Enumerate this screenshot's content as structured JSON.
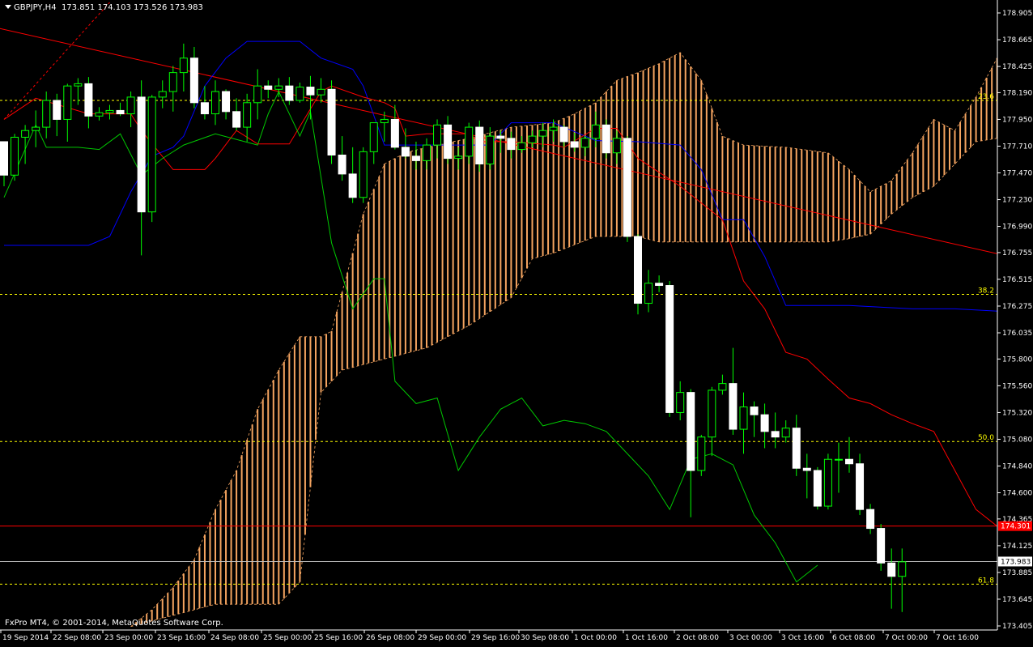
{
  "window": {
    "symbol_label": "GBPJPY,H4",
    "ohlc_label": "173.851 174.103 173.526 173.983",
    "copyright": "FxPro MT4, © 2001-2014, MetaQuotes Software Corp."
  },
  "colors": {
    "background": "#000000",
    "axis": "#ffffff",
    "bull_candle": "#000000",
    "bear_candle": "#ffffff",
    "wick": "#00ff00",
    "tenkan": "#ff0000",
    "kijun": "#0000ff",
    "chikou": "#00c800",
    "cloud_bull": "#f4a460",
    "cloud_bear": "#d8bfd8",
    "fib": "#ffff00",
    "trendline": "#ff0000",
    "hline": "#ff0000",
    "bid_line": "#c0c0c0"
  },
  "chart_data": {
    "type": "candlestick",
    "symbol": "GBPJPY",
    "timeframe": "H4",
    "ylim": [
      173.405,
      178.905
    ],
    "y_ticks": [
      "178.905",
      "178.665",
      "178.425",
      "178.190",
      "177.950",
      "177.710",
      "177.470",
      "177.230",
      "176.990",
      "176.755",
      "176.515",
      "176.275",
      "176.035",
      "175.800",
      "175.560",
      "175.320",
      "175.080",
      "174.840",
      "174.600",
      "174.365",
      "174.125",
      "173.885",
      "173.645",
      "173.405"
    ],
    "x_labels": [
      "19 Sep 2014",
      "22 Sep 08:00",
      "23 Sep 00:00",
      "23 Sep 16:00",
      "24 Sep 08:00",
      "25 Sep 00:00",
      "25 Sep 16:00",
      "26 Sep 08:00",
      "29 Sep 00:00",
      "29 Sep 16:00",
      "30 Sep 08:00",
      "1 Oct 00:00",
      "1 Oct 16:00",
      "2 Oct 08:00",
      "3 Oct 00:00",
      "3 Oct 16:00",
      "6 Oct 08:00",
      "7 Oct 00:00",
      "7 Oct 16:00"
    ],
    "candles": [
      [
        177.75,
        177.75,
        177.35,
        177.45
      ],
      [
        177.45,
        177.82,
        177.4,
        177.79
      ],
      [
        177.79,
        177.9,
        177.55,
        177.85
      ],
      [
        177.85,
        178.03,
        177.7,
        177.88
      ],
      [
        177.88,
        178.2,
        177.78,
        178.12
      ],
      [
        178.12,
        178.18,
        177.8,
        177.95
      ],
      [
        177.95,
        178.27,
        177.75,
        178.25
      ],
      [
        178.25,
        178.32,
        178.08,
        178.27
      ],
      [
        178.27,
        178.33,
        177.87,
        177.98
      ],
      [
        177.98,
        178.06,
        177.94,
        178.01
      ],
      [
        178.01,
        178.08,
        177.95,
        178.03
      ],
      [
        178.03,
        178.1,
        177.98,
        178.0
      ],
      [
        178.0,
        178.2,
        177.88,
        178.15
      ],
      [
        178.15,
        178.3,
        176.73,
        177.12
      ],
      [
        177.12,
        178.17,
        177.03,
        178.15
      ],
      [
        178.15,
        178.3,
        178.05,
        178.2
      ],
      [
        178.2,
        178.43,
        178.02,
        178.37
      ],
      [
        178.37,
        178.63,
        178.2,
        178.5
      ],
      [
        178.5,
        178.6,
        178.05,
        178.1
      ],
      [
        178.1,
        178.25,
        177.95,
        178.0
      ],
      [
        178.0,
        178.3,
        177.9,
        178.2
      ],
      [
        178.2,
        178.22,
        177.95,
        178.02
      ],
      [
        178.02,
        178.14,
        177.85,
        177.88
      ],
      [
        177.88,
        178.18,
        177.75,
        178.1
      ],
      [
        178.1,
        178.4,
        177.95,
        178.25
      ],
      [
        178.25,
        178.3,
        178.14,
        178.22
      ],
      [
        178.22,
        178.32,
        178.15,
        178.25
      ],
      [
        178.25,
        178.33,
        178.08,
        178.12
      ],
      [
        178.12,
        178.28,
        178.1,
        178.24
      ],
      [
        178.24,
        178.34,
        177.95,
        178.17
      ],
      [
        178.17,
        178.32,
        178.1,
        178.22
      ],
      [
        178.22,
        178.3,
        177.55,
        177.63
      ],
      [
        177.63,
        177.8,
        177.4,
        177.46
      ],
      [
        177.46,
        177.7,
        177.2,
        177.25
      ],
      [
        177.25,
        177.7,
        177.2,
        177.66
      ],
      [
        177.66,
        177.9,
        177.55,
        177.92
      ],
      [
        177.92,
        178.02,
        177.75,
        177.95
      ],
      [
        177.95,
        178.08,
        177.68,
        177.7
      ],
      [
        177.7,
        177.87,
        177.6,
        177.62
      ],
      [
        177.62,
        177.75,
        177.5,
        177.58
      ],
      [
        177.58,
        177.78,
        177.5,
        177.72
      ],
      [
        177.72,
        177.95,
        177.6,
        177.9
      ],
      [
        177.9,
        177.98,
        177.55,
        177.6
      ],
      [
        177.6,
        177.7,
        177.5,
        177.62
      ],
      [
        177.62,
        177.92,
        177.55,
        177.88
      ],
      [
        177.88,
        177.94,
        177.48,
        177.55
      ],
      [
        177.55,
        177.88,
        177.5,
        177.8
      ],
      [
        177.8,
        177.85,
        177.65,
        177.78
      ],
      [
        177.78,
        177.84,
        177.6,
        177.68
      ],
      [
        177.68,
        177.8,
        177.65,
        177.74
      ],
      [
        177.74,
        177.85,
        177.7,
        177.8
      ],
      [
        177.8,
        177.92,
        177.7,
        177.85
      ],
      [
        177.85,
        177.95,
        177.75,
        177.88
      ],
      [
        177.88,
        177.9,
        177.7,
        177.75
      ],
      [
        177.75,
        177.83,
        177.66,
        177.7
      ],
      [
        177.7,
        177.8,
        177.62,
        177.78
      ],
      [
        177.78,
        178.02,
        177.7,
        177.9
      ],
      [
        177.9,
        177.95,
        177.6,
        177.65
      ],
      [
        177.65,
        177.85,
        177.55,
        177.78
      ],
      [
        177.78,
        177.8,
        176.85,
        176.9
      ],
      [
        176.9,
        176.92,
        176.2,
        176.3
      ],
      [
        176.3,
        176.6,
        176.22,
        176.48
      ],
      [
        176.48,
        176.55,
        176.4,
        176.46
      ],
      [
        176.46,
        176.5,
        175.28,
        175.32
      ],
      [
        175.32,
        175.6,
        175.25,
        175.5
      ],
      [
        175.5,
        175.53,
        174.38,
        174.8
      ],
      [
        174.8,
        175.12,
        174.75,
        175.1
      ],
      [
        175.1,
        175.55,
        174.93,
        175.52
      ],
      [
        175.52,
        175.66,
        175.48,
        175.58
      ],
      [
        175.58,
        175.9,
        175.12,
        175.17
      ],
      [
        175.17,
        175.5,
        174.95,
        175.37
      ],
      [
        175.37,
        175.42,
        175.1,
        175.3
      ],
      [
        175.3,
        175.4,
        175.0,
        175.15
      ],
      [
        175.15,
        175.32,
        175.0,
        175.1
      ],
      [
        175.1,
        175.25,
        175.05,
        175.18
      ],
      [
        175.18,
        175.3,
        174.75,
        174.82
      ],
      [
        174.82,
        174.95,
        174.55,
        174.8
      ],
      [
        174.8,
        174.83,
        174.45,
        174.48
      ],
      [
        174.48,
        174.95,
        174.45,
        174.9
      ],
      [
        174.9,
        175.05,
        174.6,
        174.9
      ],
      [
        174.9,
        175.1,
        174.78,
        174.86
      ],
      [
        174.86,
        174.95,
        174.4,
        174.45
      ],
      [
        174.45,
        174.5,
        174.23,
        174.28
      ],
      [
        174.28,
        174.32,
        173.9,
        173.97
      ],
      [
        173.97,
        174.1,
        173.56,
        173.85
      ],
      [
        173.85,
        174.1,
        173.53,
        173.98
      ]
    ],
    "tenkan": [
      [
        0,
        177.95
      ],
      [
        3,
        178.14
      ],
      [
        8,
        178.0
      ],
      [
        12,
        178.0
      ],
      [
        13,
        177.85
      ],
      [
        16,
        177.5
      ],
      [
        19,
        177.5
      ],
      [
        20,
        177.6
      ],
      [
        22,
        177.85
      ],
      [
        24,
        177.73
      ],
      [
        26,
        177.73
      ],
      [
        27,
        177.73
      ],
      [
        30,
        178.2
      ],
      [
        31,
        178.25
      ],
      [
        34,
        178.15
      ],
      [
        36,
        178.1
      ],
      [
        37,
        178.05
      ],
      [
        38,
        177.8
      ],
      [
        40,
        177.82
      ],
      [
        44,
        177.82
      ],
      [
        45,
        177.75
      ],
      [
        48,
        177.75
      ],
      [
        52,
        177.72
      ],
      [
        53,
        177.7
      ],
      [
        56,
        177.87
      ],
      [
        58,
        177.87
      ],
      [
        60,
        177.6
      ],
      [
        64,
        177.35
      ],
      [
        68,
        177.05
      ],
      [
        70,
        176.5
      ],
      [
        72,
        176.25
      ],
      [
        74,
        175.86
      ],
      [
        76,
        175.8
      ],
      [
        78,
        175.62
      ],
      [
        80,
        175.45
      ],
      [
        82,
        175.4
      ],
      [
        84,
        175.3
      ],
      [
        86,
        175.22
      ],
      [
        88,
        175.15
      ],
      [
        90,
        174.8
      ],
      [
        92,
        174.45
      ],
      [
        94,
        174.3
      ],
      [
        96,
        174.2
      ],
      [
        98,
        174.15
      ],
      [
        100,
        174.1
      ]
    ],
    "kijun": [
      [
        0,
        176.82
      ],
      [
        8,
        176.82
      ],
      [
        10,
        176.9
      ],
      [
        12,
        177.3
      ],
      [
        14,
        177.62
      ],
      [
        16,
        177.7
      ],
      [
        17,
        177.8
      ],
      [
        19,
        178.25
      ],
      [
        21,
        178.5
      ],
      [
        23,
        178.65
      ],
      [
        28,
        178.65
      ],
      [
        30,
        178.5
      ],
      [
        33,
        178.4
      ],
      [
        34,
        178.25
      ],
      [
        36,
        177.72
      ],
      [
        40,
        177.72
      ],
      [
        44,
        177.72
      ],
      [
        46,
        177.72
      ],
      [
        48,
        177.92
      ],
      [
        52,
        177.92
      ],
      [
        56,
        177.76
      ],
      [
        60,
        177.75
      ],
      [
        64,
        177.72
      ],
      [
        66,
        177.5
      ],
      [
        68,
        177.05
      ],
      [
        70,
        177.05
      ],
      [
        72,
        176.72
      ],
      [
        74,
        176.28
      ],
      [
        78,
        176.28
      ],
      [
        80,
        176.28
      ],
      [
        86,
        176.25
      ],
      [
        90,
        176.25
      ],
      [
        96,
        176.22
      ],
      [
        98,
        175.95
      ],
      [
        100,
        175.3
      ]
    ],
    "senkou_a": [
      [
        12,
        173.4
      ],
      [
        14,
        173.55
      ],
      [
        16,
        173.75
      ],
      [
        18,
        174.0
      ],
      [
        20,
        174.45
      ],
      [
        22,
        174.8
      ],
      [
        24,
        175.35
      ],
      [
        26,
        175.7
      ],
      [
        28,
        176.0
      ],
      [
        30,
        176.0
      ],
      [
        31,
        176.05
      ],
      [
        32,
        176.4
      ],
      [
        34,
        177.1
      ],
      [
        36,
        177.55
      ],
      [
        38,
        177.65
      ],
      [
        40,
        177.7
      ],
      [
        44,
        177.78
      ],
      [
        48,
        177.88
      ],
      [
        52,
        177.92
      ],
      [
        54,
        178.0
      ],
      [
        56,
        178.1
      ],
      [
        58,
        178.3
      ],
      [
        60,
        178.37
      ],
      [
        62,
        178.45
      ],
      [
        64,
        178.55
      ],
      [
        66,
        178.3
      ],
      [
        68,
        177.8
      ],
      [
        70,
        177.72
      ],
      [
        74,
        177.7
      ],
      [
        78,
        177.65
      ],
      [
        80,
        177.5
      ],
      [
        82,
        177.3
      ],
      [
        84,
        177.4
      ],
      [
        86,
        177.65
      ],
      [
        88,
        177.95
      ],
      [
        90,
        177.85
      ],
      [
        92,
        178.15
      ],
      [
        94,
        178.5
      ],
      [
        96,
        178.6
      ],
      [
        98,
        178.6
      ],
      [
        100,
        178.62
      ],
      [
        102,
        178.3
      ],
      [
        104,
        177.92
      ],
      [
        106,
        177.3
      ]
    ],
    "senkou_b": [
      [
        12,
        173.4
      ],
      [
        20,
        173.6
      ],
      [
        26,
        173.6
      ],
      [
        28,
        173.8
      ],
      [
        30,
        175.5
      ],
      [
        32,
        175.7
      ],
      [
        36,
        175.8
      ],
      [
        40,
        175.9
      ],
      [
        44,
        176.1
      ],
      [
        48,
        176.35
      ],
      [
        50,
        176.7
      ],
      [
        52,
        176.75
      ],
      [
        56,
        176.9
      ],
      [
        58,
        176.9
      ],
      [
        60,
        176.9
      ],
      [
        62,
        176.85
      ],
      [
        70,
        176.85
      ],
      [
        78,
        176.85
      ],
      [
        80,
        176.88
      ],
      [
        82,
        176.92
      ],
      [
        84,
        177.1
      ],
      [
        86,
        177.25
      ],
      [
        88,
        177.35
      ],
      [
        90,
        177.55
      ],
      [
        92,
        177.75
      ],
      [
        94,
        177.78
      ],
      [
        96,
        177.75
      ],
      [
        98,
        177.7
      ],
      [
        100,
        177.75
      ],
      [
        102,
        177.65
      ],
      [
        104,
        177.3
      ],
      [
        106,
        177.1
      ]
    ],
    "chikou": [
      [
        0,
        177.25
      ],
      [
        3,
        177.9
      ],
      [
        4,
        177.7
      ],
      [
        7,
        177.7
      ],
      [
        9,
        177.68
      ],
      [
        11,
        177.82
      ],
      [
        13,
        177.45
      ],
      [
        15,
        177.6
      ],
      [
        17,
        177.72
      ],
      [
        20,
        177.82
      ],
      [
        24,
        177.72
      ],
      [
        25,
        178.0
      ],
      [
        26,
        178.2
      ],
      [
        28,
        177.8
      ],
      [
        29,
        178.02
      ],
      [
        31,
        176.84
      ],
      [
        33,
        176.25
      ],
      [
        35,
        176.52
      ],
      [
        36,
        176.52
      ],
      [
        37,
        175.6
      ],
      [
        39,
        175.4
      ],
      [
        41,
        175.45
      ],
      [
        43,
        174.8
      ],
      [
        45,
        175.1
      ],
      [
        47,
        175.35
      ],
      [
        49,
        175.45
      ],
      [
        51,
        175.2
      ],
      [
        53,
        175.25
      ],
      [
        55,
        175.22
      ],
      [
        57,
        175.15
      ],
      [
        59,
        174.95
      ],
      [
        61,
        174.75
      ],
      [
        63,
        174.45
      ],
      [
        65,
        174.9
      ],
      [
        67,
        174.95
      ],
      [
        69,
        174.85
      ],
      [
        71,
        174.4
      ],
      [
        73,
        174.15
      ],
      [
        75,
        173.8
      ],
      [
        77,
        173.95
      ]
    ],
    "fib_levels": [
      {
        "label": "23.6",
        "price": 178.12
      },
      {
        "label": "38.2",
        "price": 176.38
      },
      {
        "label": "50.0",
        "price": 175.06
      },
      {
        "label": "61.8",
        "price": 173.78
      }
    ],
    "horizontal_line": {
      "label": "174.301",
      "price": 174.301
    },
    "bid": {
      "label": "173.983",
      "price": 173.983
    },
    "trendline": {
      "from": [
        -2,
        178.8
      ],
      "to": [
        112,
        176.36
      ]
    },
    "trendline2": {
      "from": [
        0,
        177.95
      ],
      "to": [
        10,
        179.0
      ]
    }
  }
}
